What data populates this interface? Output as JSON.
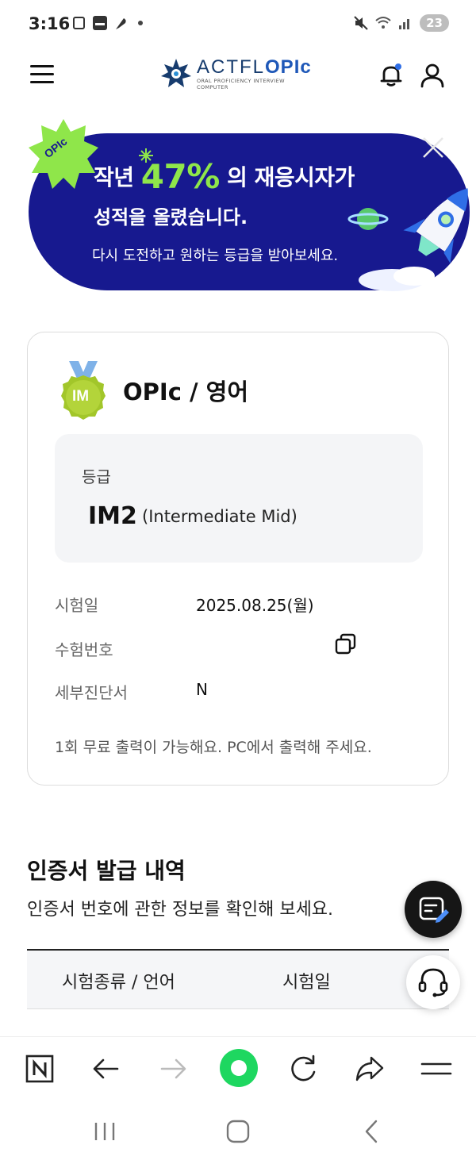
{
  "status_bar": {
    "time": "3:16",
    "left_icons": [
      "screenshot-icon",
      "allone-app-icon",
      "feather-icon",
      "dot-icon"
    ],
    "right_icons": [
      "mute-icon",
      "wifi-icon",
      "signal-icon"
    ],
    "battery": "23"
  },
  "header": {
    "logo_main": "ACTFL",
    "logo_bold": "OPIc",
    "logo_sub1": "ORAL PROFICIENCY INTERVIEW",
    "logo_sub2": "COMPUTER",
    "icons": [
      "menu-icon",
      "bell-icon",
      "user-icon"
    ]
  },
  "banner": {
    "badge": "OPIc",
    "line1_pre": "작년",
    "line1_pct": "47%",
    "line1_post": "의 재응시자가",
    "line2": "성적을 올렸습니다.",
    "line3": "다시 도전하고 원하는 등급을 받아보세요."
  },
  "result_card": {
    "medal_text": "IM",
    "title": "OPIc / 영어",
    "grade_label": "등급",
    "grade_value": "IM2",
    "grade_desc": "(Intermediate Mid)",
    "rows": [
      {
        "label": "시험일",
        "value": "2025.08.25(월)"
      },
      {
        "label": "수험번호",
        "value": ""
      },
      {
        "label": "세부진단서",
        "value": "N"
      }
    ],
    "note": "1회 무료 출력이 가능해요. PC에서 출력해 주세요."
  },
  "certificate": {
    "title": "인증서 발급 내역",
    "subtitle": "인증서 번호에 관한 정보를 확인해 보세요.",
    "columns": [
      "시험종류 / 언어",
      "시험일"
    ]
  },
  "colors": {
    "banner_bg": "#17198f",
    "accent_green": "#8fe64a",
    "brand_blue": "#1f58b8",
    "browser_green": "#1ed760"
  },
  "browser_toolbar": [
    "naver-icon",
    "back-arrow-icon",
    "forward-arrow-icon",
    "green-home-icon",
    "refresh-icon",
    "share-icon",
    "menu-lines-icon"
  ],
  "android_nav": [
    "recents-icon",
    "home-icon",
    "back-icon"
  ]
}
